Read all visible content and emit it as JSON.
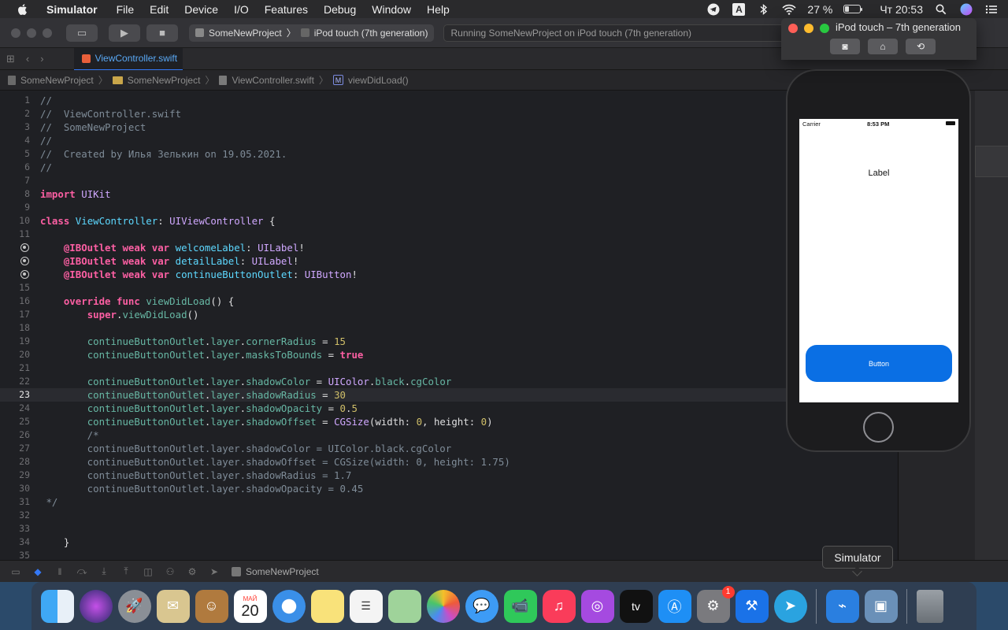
{
  "menubar": {
    "app_name": "Simulator",
    "items": [
      "File",
      "Edit",
      "Device",
      "I/O",
      "Features",
      "Debug",
      "Window",
      "Help"
    ],
    "status": {
      "input_source": "A",
      "battery_percent": "27 %",
      "battery_level": 0.27,
      "clock": "Чт 20:53"
    }
  },
  "xcode": {
    "scheme": {
      "project": "SomeNewProject",
      "device": "iPod touch (7th generation)"
    },
    "status_text": "Running SomeNewProject on iPod touch (7th generation)",
    "tab": {
      "label": "ViewController.swift"
    },
    "jumpbar": {
      "project": "SomeNewProject",
      "group": "SomeNewProject",
      "file": "ViewController.swift",
      "method_badge": "M",
      "method": "viewDidLoad()"
    },
    "current_line": 23,
    "debug_bar": {
      "target": "SomeNewProject"
    }
  },
  "code_lines": [
    {
      "n": "1",
      "t": "//"
    },
    {
      "n": "2",
      "t": "//  ViewController.swift"
    },
    {
      "n": "3",
      "t": "//  SomeNewProject"
    },
    {
      "n": "4",
      "t": "//"
    },
    {
      "n": "5",
      "t": "//  Created by Илья Зелькин on 19.05.2021."
    },
    {
      "n": "6",
      "t": "//"
    },
    {
      "n": "7",
      "t": ""
    },
    {
      "n": "8",
      "t": "import UIKit"
    },
    {
      "n": "9",
      "t": ""
    },
    {
      "n": "10",
      "t": "class ViewController: UIViewController {"
    },
    {
      "n": "11",
      "t": ""
    },
    {
      "n": "12",
      "t": "    @IBOutlet weak var welcomeLabel: UILabel!"
    },
    {
      "n": "13",
      "t": "    @IBOutlet weak var detailLabel: UILabel!"
    },
    {
      "n": "14",
      "t": "    @IBOutlet weak var continueButtonOutlet: UIButton!"
    },
    {
      "n": "15",
      "t": ""
    },
    {
      "n": "16",
      "t": "    override func viewDidLoad() {"
    },
    {
      "n": "17",
      "t": "        super.viewDidLoad()"
    },
    {
      "n": "18",
      "t": ""
    },
    {
      "n": "19",
      "t": "        continueButtonOutlet.layer.cornerRadius = 15"
    },
    {
      "n": "20",
      "t": "        continueButtonOutlet.layer.masksToBounds = true"
    },
    {
      "n": "21",
      "t": ""
    },
    {
      "n": "22",
      "t": "        continueButtonOutlet.layer.shadowColor = UIColor.black.cgColor"
    },
    {
      "n": "23",
      "t": "        continueButtonOutlet.layer.shadowRadius = 30"
    },
    {
      "n": "24",
      "t": "        continueButtonOutlet.layer.shadowOpacity = 0.5"
    },
    {
      "n": "25",
      "t": "        continueButtonOutlet.layer.shadowOffset = CGSize(width: 0, height: 0)"
    },
    {
      "n": "26",
      "t": "        /*"
    },
    {
      "n": "27",
      "t": "        continueButtonOutlet.layer.shadowColor = UIColor.black.cgColor"
    },
    {
      "n": "28",
      "t": "        continueButtonOutlet.layer.shadowOffset = CGSize(width: 0, height: 1.75)"
    },
    {
      "n": "29",
      "t": "        continueButtonOutlet.layer.shadowRadius = 1.7"
    },
    {
      "n": "30",
      "t": "        continueButtonOutlet.layer.shadowOpacity = 0.45"
    },
    {
      "n": "31",
      "t": " */"
    },
    {
      "n": "32",
      "t": ""
    },
    {
      "n": "33",
      "t": ""
    },
    {
      "n": "34",
      "t": "    }"
    },
    {
      "n": "35",
      "t": ""
    }
  ],
  "simulator": {
    "window_title": "iPod touch – 7th generation",
    "status_bar": {
      "carrier": "Carrier",
      "time": "8:53 PM"
    },
    "label_text": "Label",
    "button_text": "Button",
    "button_color": "#0a6fe4",
    "tooltip": "Simulator"
  },
  "dock": {
    "calendar": {
      "month": "МАЙ",
      "day": "20"
    },
    "appletv_label": "tv",
    "system_prefs_badge": "1",
    "icons": [
      "finder-icon",
      "siri-icon",
      "launchpad-icon",
      "mail-icon",
      "contacts-icon",
      "calendar-icon",
      "safari-icon",
      "notes-icon",
      "reminders-icon",
      "maps-icon",
      "photos-icon",
      "messages-icon",
      "facetime-icon",
      "music-icon",
      "podcasts-icon",
      "appletv-icon",
      "appstore-icon",
      "system-preferences-icon",
      "xcode-icon",
      "telegram-icon",
      "simulator-icon",
      "preview-icon",
      "trash-icon"
    ]
  }
}
